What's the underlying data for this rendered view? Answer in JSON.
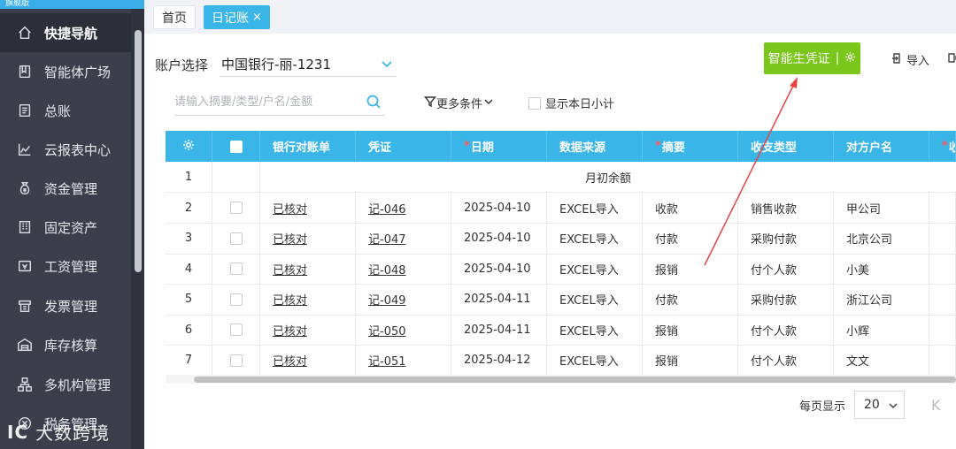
{
  "brand": {
    "text": "旗舰版"
  },
  "sidebar": {
    "items": [
      {
        "label": "快捷导航",
        "icon": "home-icon"
      },
      {
        "label": "智能体广场",
        "icon": "book-icon"
      },
      {
        "label": "总账",
        "icon": "ledger-icon"
      },
      {
        "label": "云报表中心",
        "icon": "chart-icon"
      },
      {
        "label": "资金管理",
        "icon": "money-bag-icon"
      },
      {
        "label": "固定资产",
        "icon": "building-icon"
      },
      {
        "label": "工资管理",
        "icon": "salary-icon"
      },
      {
        "label": "发票管理",
        "icon": "invoice-icon"
      },
      {
        "label": "库存核算",
        "icon": "warehouse-icon"
      },
      {
        "label": "多机构管理",
        "icon": "org-icon"
      },
      {
        "label": "税务管理",
        "icon": "tax-icon"
      }
    ]
  },
  "watermark": {
    "logo": "IC",
    "text": "大数跨境"
  },
  "tabs": {
    "home": "首页",
    "journal": "日记账",
    "close": "×"
  },
  "account": {
    "label": "账户选择",
    "value": "中国银行-丽-1231"
  },
  "toolbar": {
    "smart_voucher": "智能生凭证",
    "separator": "|",
    "import": "导入"
  },
  "filters": {
    "search_placeholder": "请输入摘要/类型/户名/金额",
    "more_conditions": "更多条件",
    "show_daily_subtotal": "显示本日小计"
  },
  "table": {
    "headers": {
      "bank_statement": "银行对账单",
      "voucher": "凭证",
      "date": "日期",
      "source": "数据来源",
      "summary": "摘要",
      "type": "收支类型",
      "party": "对方户名",
      "extra": "收"
    },
    "required_mark": "*",
    "opening_row": {
      "no": "1",
      "label": "月初余额"
    },
    "rows": [
      {
        "no": "2",
        "bank": "已核对",
        "voucher": "记-046",
        "date": "2025-04-10",
        "source": "EXCEL导入",
        "summary": "收款",
        "type": "销售收款",
        "party": "甲公司"
      },
      {
        "no": "3",
        "bank": "已核对",
        "voucher": "记-047",
        "date": "2025-04-10",
        "source": "EXCEL导入",
        "summary": "付款",
        "type": "采购付款",
        "party": "北京公司"
      },
      {
        "no": "4",
        "bank": "已核对",
        "voucher": "记-048",
        "date": "2025-04-10",
        "source": "EXCEL导入",
        "summary": "报销",
        "type": "付个人款",
        "party": "小美"
      },
      {
        "no": "5",
        "bank": "已核对",
        "voucher": "记-049",
        "date": "2025-04-11",
        "source": "EXCEL导入",
        "summary": "付款",
        "type": "采购付款",
        "party": "浙江公司"
      },
      {
        "no": "6",
        "bank": "已核对",
        "voucher": "记-050",
        "date": "2025-04-11",
        "source": "EXCEL导入",
        "summary": "报销",
        "type": "付个人款",
        "party": "小辉"
      },
      {
        "no": "7",
        "bank": "已核对",
        "voucher": "记-051",
        "date": "2025-04-12",
        "source": "EXCEL导入",
        "summary": "报销",
        "type": "付个人款",
        "party": "文文"
      }
    ]
  },
  "pager": {
    "per_page_label": "每页显示",
    "per_page_value": "20",
    "first_glyph": "K"
  },
  "colors": {
    "accent": "#3ab5e8",
    "smart_button": "#7ac61a",
    "sidebar": "#3a3f4b",
    "annotation_arrow": "#e84545"
  }
}
